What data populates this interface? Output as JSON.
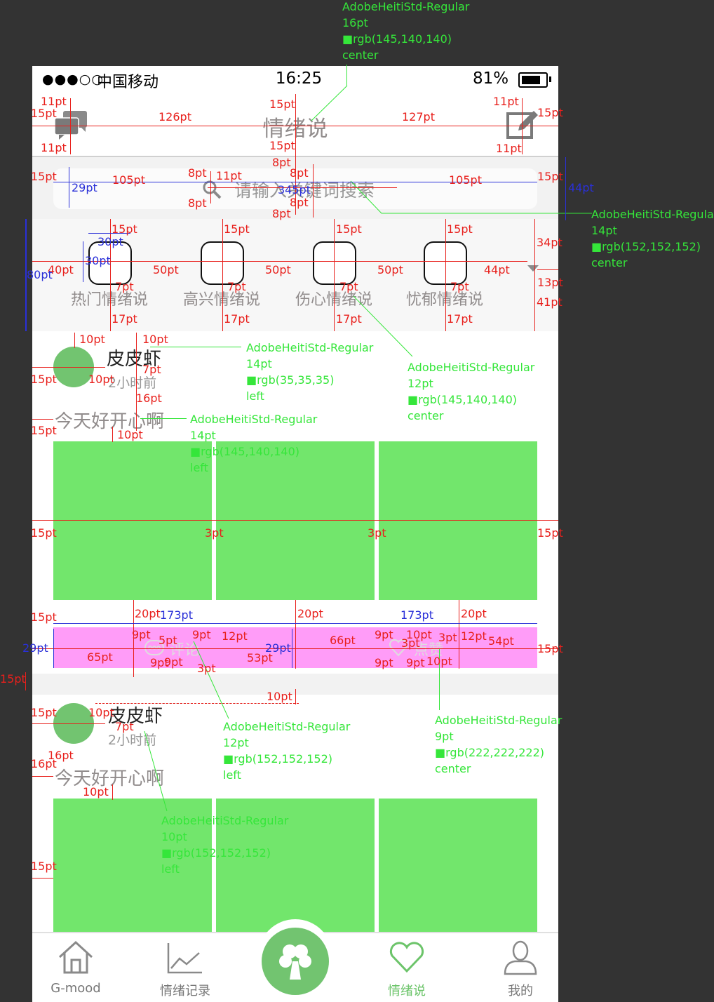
{
  "status_bar": {
    "signal": "●●●○○",
    "carrier": "中国移动",
    "time": "16:25",
    "battery": "81%"
  },
  "nav": {
    "title": "情绪说"
  },
  "search": {
    "placeholder": "请输入关键词搜索"
  },
  "categories": [
    {
      "label": "热门情绪说"
    },
    {
      "label": "高兴情绪说"
    },
    {
      "label": "伤心情绪说"
    },
    {
      "label": "忧郁情绪说"
    }
  ],
  "posts": [
    {
      "username": "皮皮虾",
      "time": "2小时前",
      "text": "今天好开心啊",
      "comment_label": "评论",
      "like_label": "点赞"
    },
    {
      "username": "皮皮虾",
      "time": "2小时前",
      "text": "今天好开心啊"
    }
  ],
  "tabbar": {
    "items": [
      {
        "label": "G-mood",
        "icon": "house-icon"
      },
      {
        "label": "情绪记录",
        "icon": "chart-icon"
      },
      {
        "label": "",
        "icon": "clover-icon"
      },
      {
        "label": "情绪说",
        "icon": "heart-icon"
      },
      {
        "label": "我的",
        "icon": "person-icon"
      }
    ],
    "active_color": "#6cc46a"
  },
  "annotations": {
    "specs": [
      {
        "font": "AdobeHeitiStd-Regular",
        "size": "16pt",
        "color": "rgb(145,140,140)",
        "align": "center"
      },
      {
        "font": "AdobeHeitiStd-Regular",
        "size": "14pt",
        "color": "rgb(152,152,152)",
        "align": "center"
      },
      {
        "font": "AdobeHeitiStd-Regular",
        "size": "14pt",
        "color": "rgb(35,35,35)",
        "align": "left"
      },
      {
        "font": "AdobeHeitiStd-Regular",
        "size": "12pt",
        "color": "rgb(145,140,140)",
        "align": "center"
      },
      {
        "font": "AdobeHeitiStd-Regular",
        "size": "14pt",
        "color": "rgb(145,140,140)",
        "align": "left"
      },
      {
        "font": "AdobeHeitiStd-Regular",
        "size": "12pt",
        "color": "rgb(152,152,152)",
        "align": "left"
      },
      {
        "font": "AdobeHeitiStd-Regular",
        "size": "9pt",
        "color": "rgb(222,222,222)",
        "align": "center"
      },
      {
        "font": "AdobeHeitiStd-Regular",
        "size": "10pt",
        "color": "rgb(152,152,152)",
        "align": "left"
      }
    ],
    "labels": {
      "p15": "15pt",
      "p11": "11pt",
      "p126": "126pt",
      "p127": "127pt",
      "p8": "8pt",
      "p105": "105pt",
      "p29": "29pt",
      "p345": "345pt",
      "p44": "44pt",
      "p30": "30pt",
      "p80": "80pt",
      "p40": "40pt",
      "p50": "50pt",
      "p34": "34pt",
      "p13": "13pt",
      "p41": "41pt",
      "p7": "7pt",
      "p17": "17pt",
      "p10": "10pt",
      "p16": "16pt",
      "p3": "3pt",
      "p20": "20pt",
      "p173": "173pt",
      "p9": "9pt",
      "p5": "5pt",
      "p12": "12pt",
      "p65": "65pt",
      "p53": "53pt",
      "p66": "66pt",
      "p54": "54pt"
    }
  }
}
